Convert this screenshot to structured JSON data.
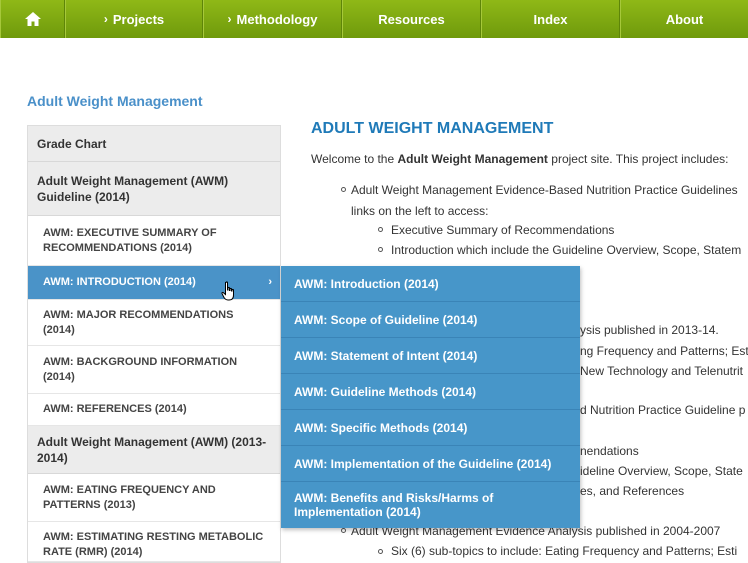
{
  "nav": {
    "home_icon": "home-icon",
    "items": [
      "Projects",
      "Methodology",
      "Resources",
      "Index",
      "About"
    ]
  },
  "page_heading": "Adult Weight Management",
  "sidebar": {
    "items": [
      {
        "type": "group",
        "label": "Grade Chart"
      },
      {
        "type": "group",
        "label": "Adult Weight Management (AWM) Guideline (2014)"
      },
      {
        "type": "item",
        "label": "AWM: EXECUTIVE SUMMARY OF RECOMMENDATIONS (2014)"
      },
      {
        "type": "item",
        "label": "AWM: INTRODUCTION (2014)",
        "active": true
      },
      {
        "type": "item",
        "label": "AWM: MAJOR RECOMMENDATIONS (2014)"
      },
      {
        "type": "item",
        "label": "AWM: BACKGROUND INFORMATION (2014)"
      },
      {
        "type": "item",
        "label": "AWM: REFERENCES (2014)"
      },
      {
        "type": "group",
        "label": "Adult Weight Management (AWM) (2013-2014)"
      },
      {
        "type": "item",
        "label": "AWM: EATING FREQUENCY AND PATTERNS (2013)"
      },
      {
        "type": "item",
        "label": "AWM: ESTIMATING RESTING METABOLIC RATE (RMR) (2014)"
      }
    ]
  },
  "flyout": {
    "items": [
      "AWM: Introduction (2014)",
      "AWM: Scope of Guideline (2014)",
      "AWM: Statement of Intent (2014)",
      "AWM: Guideline Methods (2014)",
      "AWM: Specific Methods (2014)",
      "AWM: Implementation of the Guideline (2014)",
      "AWM: Benefits and Risks/Harms of Implementation (2014)"
    ]
  },
  "content": {
    "title": "ADULT WEIGHT MANAGEMENT",
    "intro_prefix": "Welcome to the ",
    "intro_bold": "Adult Weight Management",
    "intro_suffix": " project site. This project includes:",
    "lines": [
      "Adult Weight Management Evidence-Based Nutrition Practice Guidelines",
      "links on the left to access:",
      "Executive Summary of Recommendations",
      "Introduction which include the Guideline Overview, Scope, Statem",
      "ysis published in 2013-14.",
      "ng Frequency and Patterns; Esti",
      "New Technology and Telenutrit",
      "d Nutrition Practice Guideline p",
      "nendations",
      "ideline Overview, Scope, State",
      "es, and References",
      "Adult Weight Management Evidence Analysis published in 2004-2007",
      "Six (6) sub-topics to include: Eating Frequency and Patterns; Esti"
    ]
  }
}
